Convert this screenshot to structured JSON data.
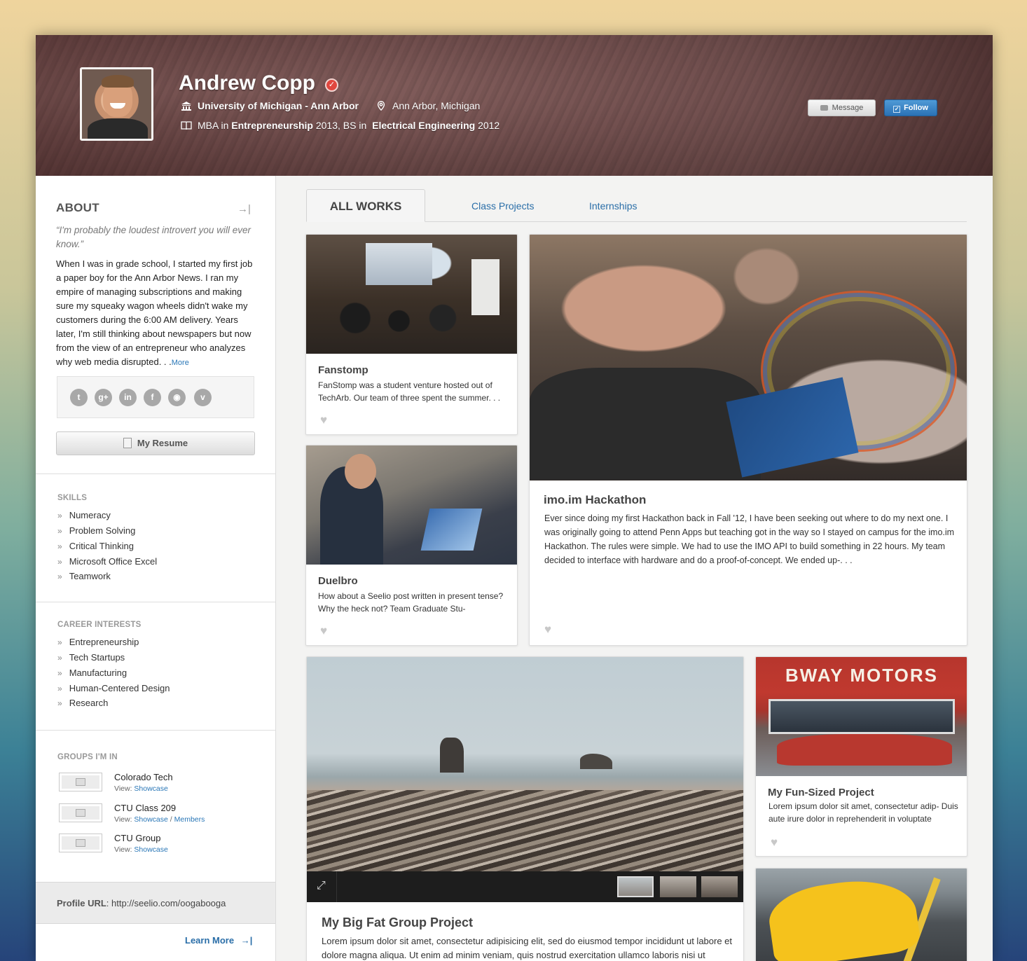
{
  "profile": {
    "name": "Andrew Copp",
    "university": "University of Michigan - Ann Arbor",
    "location": "Ann Arbor, Michigan",
    "degree_1_prefix": "MBA in ",
    "degree_1_field": "Entrepreneurship",
    "degree_1_year": " 2013, BS in ",
    "degree_2_field": "Electrical Engineering",
    "degree_2_year": " 2012"
  },
  "actions": {
    "message_label": "Message",
    "follow_label": "Follow"
  },
  "about": {
    "title": "ABOUT",
    "quote": "“I'm probably the loudest introvert you will ever know.”",
    "bio": "When I was in grade school, I started my first job a paper boy for the Ann Arbor News. I ran my empire of managing subscriptions and making sure my squeaky wagon wheels didn't wake my customers during the 6:00 AM delivery. Years later, I'm still thinking about newspapers but now from the view of an entrepreneur who analyzes why web media disrupted. . .",
    "more_label": "More",
    "resume_label": "My Resume"
  },
  "social": [
    "twitter-icon",
    "google-plus-icon",
    "linkedin-icon",
    "facebook-icon",
    "github-icon",
    "vimeo-icon"
  ],
  "skills": {
    "title": "SKILLS",
    "items": [
      "Numeracy",
      "Problem Solving",
      "Critical Thinking",
      "Microsoft Office Excel",
      "Teamwork"
    ]
  },
  "career": {
    "title": "CAREER INTERESTS",
    "items": [
      "Entrepreneurship",
      "Tech Startups",
      "Manufacturing",
      "Human-Centered Design",
      "Research"
    ]
  },
  "groups": {
    "title": "GROUPS I'M IN",
    "view_label": "View: ",
    "showcase_label": "Showcase",
    "members_label": "Members",
    "items": [
      {
        "name": "Colorado Tech"
      },
      {
        "name": "CTU Class 209"
      },
      {
        "name": "CTU Group"
      }
    ]
  },
  "footer": {
    "url_label": "Profile URL",
    "url_value": ": http://seelio.com/oogabooga",
    "learn_more": "Learn More"
  },
  "tabs": [
    "ALL WORKS",
    "Class Projects",
    "Internships"
  ],
  "works": {
    "fanstomp": {
      "title": "Fanstomp",
      "desc": "FanStomp was a student venture hosted out of TechArb. Our team of three spent the summer. . ."
    },
    "duelbro": {
      "title": "Duelbro",
      "desc": "How about a Seelio post written in present tense? Why the heck not? Team Graduate Stu-"
    },
    "hackathon": {
      "title": "imo.im Hackathon",
      "desc": "Ever since doing my first Hackathon back in Fall '12, I have been seeking out where to do my next one. I was originally going to attend Penn Apps but teaching got in the way so I stayed on campus for the imo.im Hackathon. The rules were simple. We had to use the IMO API to build something in 22 hours. My team decided to interface with hardware and do a proof-of-concept. We ended up-. . ."
    },
    "big_fat": {
      "title": "My Big Fat Group Project",
      "desc": "Lorem ipsum dolor sit amet, consectetur adipisicing elit, sed do eiusmod tempor incididunt ut labore et dolore magna aliqua. Ut enim ad minim veniam, quis nostrud exercitation ullamco laboris nisi ut"
    },
    "fun_sized": {
      "title": "My Fun-Sized Project",
      "desc": "Lorem ipsum dolor sit amet, consectetur adip- Duis aute irure dolor in reprehenderit in voluptate",
      "sign": "BWAY MOTORS"
    }
  }
}
